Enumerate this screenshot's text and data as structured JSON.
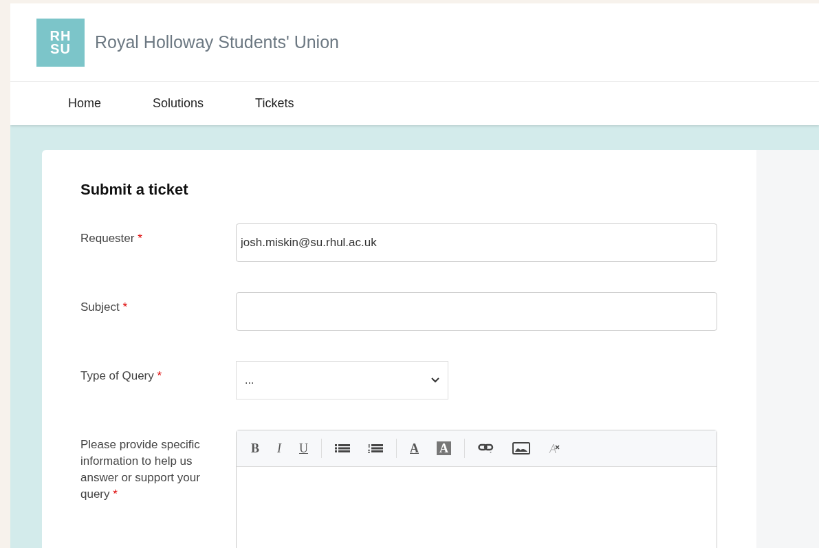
{
  "header": {
    "logo_lines": [
      "RH",
      "SU"
    ],
    "title": "Royal Holloway Students' Union"
  },
  "nav": [
    {
      "label": "Home"
    },
    {
      "label": "Solutions"
    },
    {
      "label": "Tickets"
    }
  ],
  "form": {
    "title": "Submit a ticket",
    "fields": [
      {
        "kind": "text",
        "label": "Requester",
        "required_mark": "*",
        "value": "josh.miskin@su.rhul.ac.uk"
      },
      {
        "kind": "text",
        "label": "Subject",
        "required_mark": "*"
      },
      {
        "kind": "select",
        "label": "Type of Query",
        "required_mark": "*",
        "value": "..."
      },
      {
        "kind": "editor",
        "label": "Please provide specific information to help us answer or support your query",
        "required_mark": "*",
        "toolbar": [
          [
            {
              "kind": "bold",
              "label": "B"
            },
            {
              "kind": "italic",
              "label": "I"
            },
            {
              "kind": "underline",
              "label": "U"
            }
          ],
          [
            {
              "kind": "bullets"
            },
            {
              "kind": "numbers"
            }
          ],
          [
            {
              "kind": "font-color",
              "label": "A"
            },
            {
              "kind": "highlight",
              "label": "A"
            }
          ],
          [
            {
              "kind": "link"
            },
            {
              "kind": "image"
            },
            {
              "kind": "clear"
            }
          ]
        ]
      }
    ]
  }
}
